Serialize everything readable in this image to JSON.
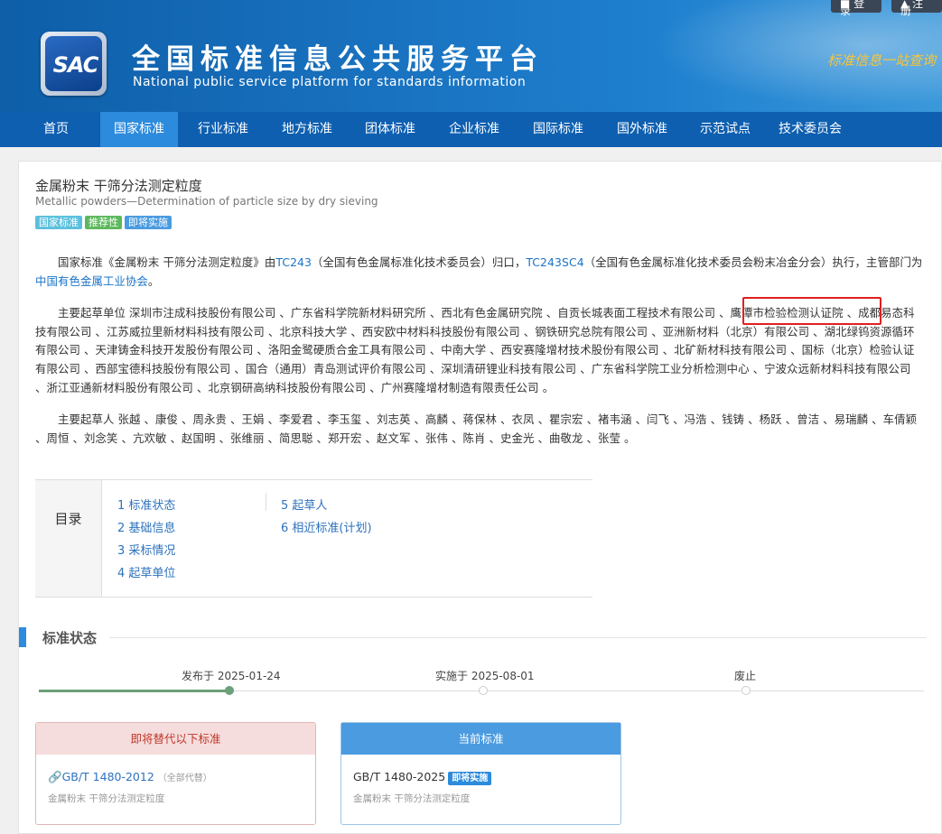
{
  "header": {
    "logo_text": "SAC",
    "title": "全国标准信息公共服务平台",
    "subtitle": "National public service platform  for standards information",
    "slogan": "标准信息一站查询",
    "login_label": "登录",
    "register_label": "注册"
  },
  "nav": {
    "items": [
      {
        "label": "首页"
      },
      {
        "label": "国家标准"
      },
      {
        "label": "行业标准"
      },
      {
        "label": "地方标准"
      },
      {
        "label": "团体标准"
      },
      {
        "label": "企业标准"
      },
      {
        "label": "国际标准"
      },
      {
        "label": "国外标准"
      },
      {
        "label": "示范试点"
      },
      {
        "label": "技术委员会"
      }
    ],
    "active": "国家标准"
  },
  "standard": {
    "title_cn": "金属粉末 干筛分法测定粒度",
    "title_en": "Metallic powders—Determination of particle size by dry sieving",
    "tags": [
      {
        "label": "国家标准",
        "color": "#5bc0de"
      },
      {
        "label": "推荐性",
        "color": "#5cb85c"
      },
      {
        "label": "即将实施",
        "color": "#4a9be0"
      }
    ],
    "intro": {
      "p1": "国家标准《金属粉末 干筛分法测定粒度》由",
      "tc1": "TC243",
      "p2": "（全国有色金属标准化技术委员会）归口，",
      "tc2": "TC243SC4",
      "p3": "（全国有色金属标准化技术委员会粉末冶金分会）执行，主管部门为",
      "dept": "中国有色金属工业协会",
      "p4": "。"
    },
    "drafting_units_label": "主要起草单位",
    "drafting_units": "深圳市注成科技股份有限公司 、广东省科学院新材料研究所 、西北有色金属研究院 、自贡长城表面工程技术有限公司 、鹰潭市检验检测认证院 、成都易态科技有限公司 、江苏威拉里新材料科技有限公司 、北京科技大学 、西安欧中材料科技股份有限公司 、钢铁研究总院有限公司 、亚洲新材料（北京）有限公司 、湖北绿钨资源循环有限公司 、天津铸金科技开发股份有限公司 、洛阳金鹭硬质合金工具有限公司 、中南大学 、西安赛隆增材技术股份有限公司 、北矿新材科技有限公司 、国标（北京）检验认证有限公司 、西部宝德科技股份有限公司 、国合（通用）青岛测试评价有限公司 、深圳清研锂业科技有限公司 、广东省科学院工业分析检测中心 、宁波众远新材料科技有限公司 、浙江亚通新材料股份有限公司 、北京钢研高纳科技股份有限公司 、广州赛隆增材制造有限责任公司 。",
    "drafters_label": "主要起草人",
    "drafters": "张越 、康俊 、周永贵 、王娟 、李爱君 、李玉玺 、刘志英 、高麟 、蒋保林 、衣凤 、瞿宗宏 、褚韦涵 、闫飞 、冯浩 、钱铸 、杨跃 、曾洁 、易瑞麟 、车倩颖 、周恒 、刘念笑 、亢欢敏 、赵国明 、张维丽 、简思聪 、郑开宏 、赵文军 、张伟 、陈肖 、史金光 、曲敬龙 、张莹 。",
    "highlighted_unit": "鹰潭市检验检测认证院"
  },
  "toc": {
    "label": "目录",
    "items": [
      {
        "label": "1  标准状态"
      },
      {
        "label": "2  基础信息"
      },
      {
        "label": "3  采标情况"
      },
      {
        "label": "4  起草单位"
      },
      {
        "label": "5  起草人"
      },
      {
        "label": "6  相近标准(计划)"
      }
    ]
  },
  "status_section": {
    "title": "标准状态",
    "timeline": [
      {
        "label": "发布于 2025-01-24",
        "done": true
      },
      {
        "label": "实施于 2025-08-01",
        "done": false
      },
      {
        "label": "废止",
        "done": false
      }
    ],
    "replaced_card": {
      "header": "即将替代以下标准",
      "header_bg": "#f6dddd",
      "header_color": "#c0392b",
      "code": "GB/T 1480-2012",
      "note": "（全部代替）",
      "desc": "金属粉末 干筛分法测定粒度"
    },
    "current_card": {
      "header": "当前标准",
      "header_bg": "#4a9be0",
      "code": "GB/T 1480-2025",
      "badge": "即将实施",
      "desc": "金属粉末 干筛分法测定粒度"
    }
  }
}
